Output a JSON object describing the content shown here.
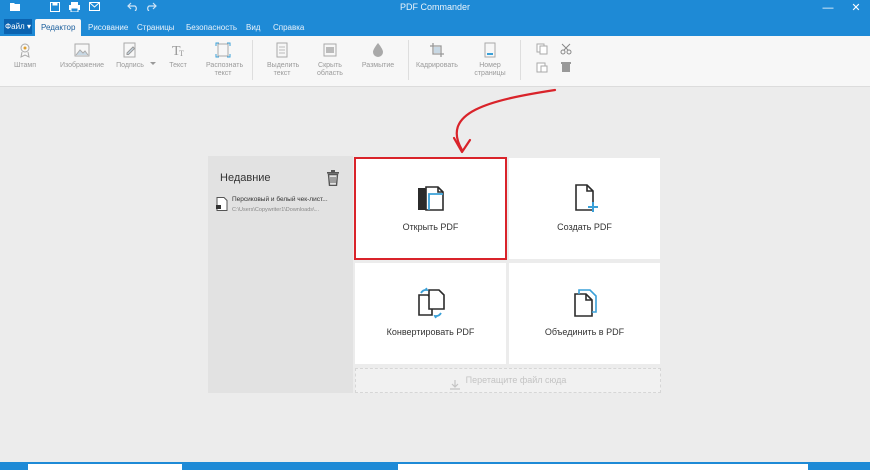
{
  "app": {
    "title": "PDF Commander"
  },
  "menu": {
    "file_label": "Файл ▾",
    "tabs": [
      "Редактор",
      "Рисование",
      "Страницы",
      "Безопасность",
      "Вид",
      "Справка"
    ],
    "active_tab": "Редактор"
  },
  "ribbon": {
    "stamp": "Штамп",
    "image": "Изображение",
    "signature": "Подпись",
    "text": "Текст",
    "recognize": "Распознать текст",
    "select_text": "Выделить текст",
    "hide_area": "Скрыть область",
    "blur": "Размытие",
    "crop": "Кадрировать",
    "page_number": "Номер страницы"
  },
  "recent": {
    "heading": "Недавние",
    "files": [
      {
        "name": "Персиковый и белый чек-лист...",
        "path": "C:\\Users\\Copywriter1\\Downloads\\..."
      }
    ]
  },
  "tiles": {
    "open": "Открыть PDF",
    "create": "Создать PDF",
    "convert": "Конвертировать PDF",
    "merge": "Объединить в PDF"
  },
  "dropzone": {
    "label": "Перетащите файл сюда"
  },
  "colors": {
    "brand": "#1e8ad6",
    "highlight": "#d9232a",
    "accent": "#3aa0d8"
  }
}
